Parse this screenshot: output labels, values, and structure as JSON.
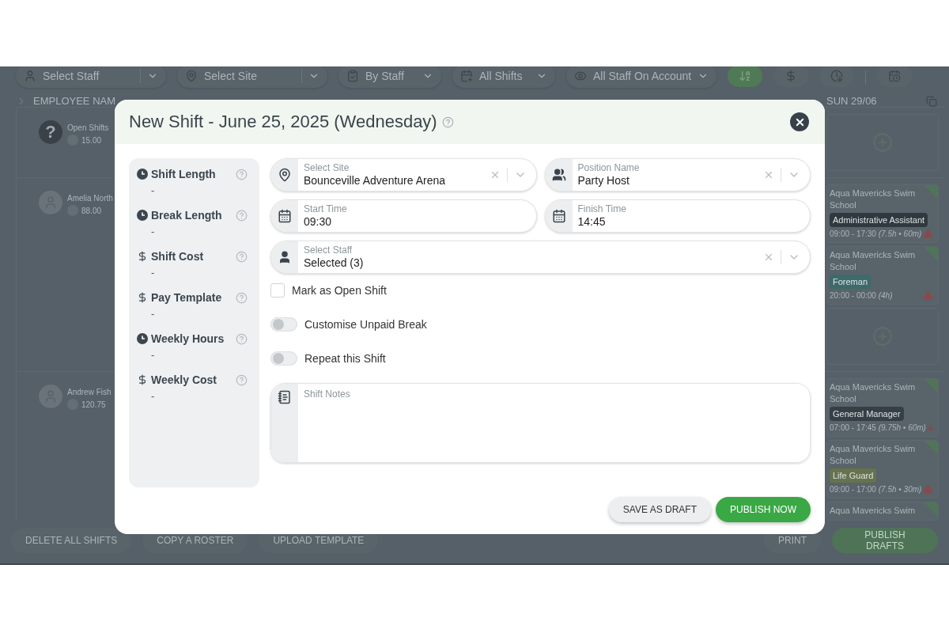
{
  "toolbar": {
    "filters": [
      {
        "label": "Select Staff",
        "kind": "search"
      },
      {
        "label": "Select Site",
        "kind": "search"
      },
      {
        "label": "By Staff",
        "kind": "plain"
      },
      {
        "label": "All Shifts",
        "kind": "plain"
      },
      {
        "label": "All Staff On Account",
        "kind": "plain"
      }
    ],
    "view_buttons": [
      {
        "kind": "sort",
        "selected": true
      },
      {
        "kind": "cost",
        "selected": false
      },
      {
        "kind": "time",
        "selected": false
      },
      {
        "kind": "calendar",
        "selected": false
      }
    ]
  },
  "roster": {
    "column_header": "EMPLOYEE NAM",
    "day_header": "SUN 29/06",
    "rows": [
      {
        "employee": {
          "kind": "open",
          "avatar_text": "?",
          "name": "Open Shifts",
          "hours": "15.00"
        },
        "shifts": [],
        "add_slot": true
      },
      {
        "employee": {
          "kind": "person",
          "name": "Amelia North",
          "hours": "88.00"
        },
        "shifts": [
          {
            "site": "Aqua Mavericks Swim School",
            "position": "Administrative Assistant",
            "color": "#30393f",
            "time": "09:00 - 17:30",
            "detail": "(7.5h • 60m)",
            "warning": true
          },
          {
            "site": "Aqua Mavericks Swim School",
            "position": "Foreman",
            "color": "#3e6a6b",
            "time": "20:00 - 00:00",
            "detail": "(4h)",
            "warning": true
          }
        ],
        "add_slot": true
      },
      {
        "employee": {
          "kind": "person",
          "name": "Andrew Fish",
          "hours": "120.75"
        },
        "shifts": [
          {
            "site": "Aqua Mavericks Swim School",
            "position": "General Manager",
            "color": "#363f45",
            "time": "07:00 - 17:45",
            "detail": "(9.75h • 60m)",
            "warning": true
          },
          {
            "site": "Aqua Mavericks Swim School",
            "position": "Life Guard",
            "color": "#66734c",
            "time": "09:00 - 17:00",
            "detail": "(7.5h • 30m)",
            "warning": true
          },
          {
            "site": "Aqua Mavericks Swim"
          }
        ]
      }
    ]
  },
  "footer": {
    "left": [
      "DELETE ALL SHIFTS",
      "COPY A ROSTER",
      "UPLOAD TEMPLATE"
    ],
    "right": [
      {
        "label": "PRINT",
        "kind": "secondary"
      },
      {
        "label": "PUBLISH DRAFTS",
        "kind": "primary"
      }
    ]
  },
  "modal": {
    "title": "New Shift - June 25, 2025 (Wednesday)",
    "summary": [
      {
        "kind": "time",
        "label": "Shift Length",
        "value": "-"
      },
      {
        "kind": "time",
        "label": "Break Length",
        "value": "-"
      },
      {
        "kind": "cost",
        "label": "Shift Cost",
        "value": "-"
      },
      {
        "kind": "cost",
        "label": "Pay Template",
        "value": "-"
      },
      {
        "kind": "time",
        "label": "Weekly Hours",
        "value": "-"
      },
      {
        "kind": "cost",
        "label": "Weekly Cost",
        "value": "-"
      }
    ],
    "field_rows": [
      [
        {
          "kind": "site",
          "label": "Select Site",
          "value": "Bounceville Adventure Arena",
          "clearable": true
        },
        {
          "kind": "position",
          "label": "Position Name",
          "value": "Party Host",
          "clearable": true
        }
      ],
      [
        {
          "kind": "time",
          "label": "Start Time",
          "value": "09:30",
          "clearable": false
        },
        {
          "kind": "time",
          "label": "Finish Time",
          "value": "14:45",
          "clearable": false
        }
      ],
      [
        {
          "kind": "staff",
          "label": "Select Staff",
          "value": "Selected (3)",
          "clearable": true
        }
      ]
    ],
    "options": [
      {
        "kind": "checkbox",
        "label": "Mark as Open Shift",
        "checked": false
      },
      {
        "kind": "toggle",
        "label": "Customise Unpaid Break",
        "on": false
      },
      {
        "kind": "toggle",
        "label": "Repeat this Shift",
        "on": false
      }
    ],
    "notes": {
      "label": "Shift Notes"
    },
    "buttons": [
      {
        "kind": "secondary",
        "label": "SAVE AS DRAFT"
      },
      {
        "kind": "primary",
        "label": "PUBLISH NOW"
      }
    ]
  }
}
